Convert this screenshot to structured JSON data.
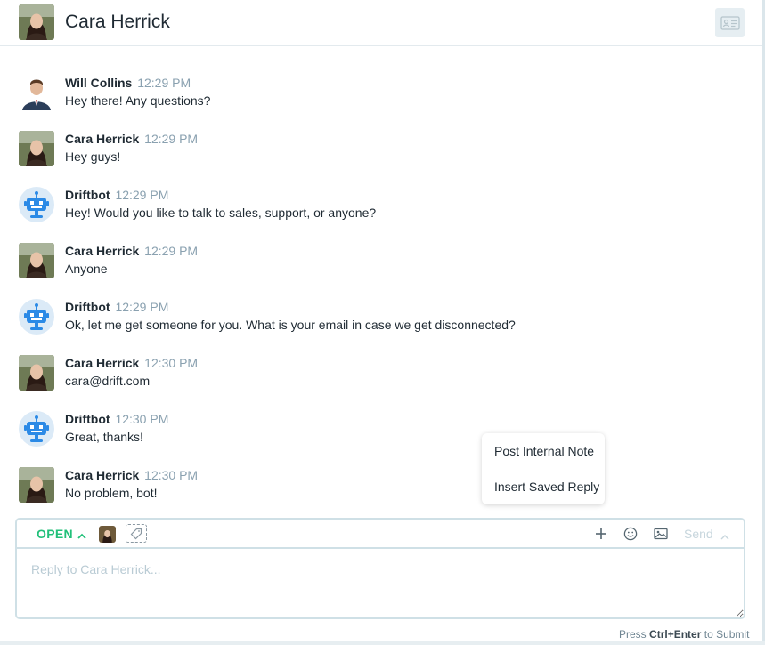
{
  "header": {
    "title": "Cara Herrick"
  },
  "messages": [
    {
      "name": "Will Collins",
      "time": "12:29 PM",
      "text": "Hey there! Any questions?",
      "avatar": "will"
    },
    {
      "name": "Cara Herrick",
      "time": "12:29 PM",
      "text": "Hey guys!",
      "avatar": "cara"
    },
    {
      "name": "Driftbot",
      "time": "12:29 PM",
      "text": "Hey! Would you like to talk to sales, support, or anyone?",
      "avatar": "bot"
    },
    {
      "name": "Cara Herrick",
      "time": "12:29 PM",
      "text": "Anyone",
      "avatar": "cara"
    },
    {
      "name": "Driftbot",
      "time": "12:29 PM",
      "text": "Ok, let me get someone for you. What is your email in case we get disconnected?",
      "avatar": "bot"
    },
    {
      "name": "Cara Herrick",
      "time": "12:30 PM",
      "text": "cara@drift.com",
      "avatar": "cara"
    },
    {
      "name": "Driftbot",
      "time": "12:30 PM",
      "text": "Great, thanks!",
      "avatar": "bot"
    },
    {
      "name": "Cara Herrick",
      "time": "12:30 PM",
      "text": "No problem, bot!",
      "avatar": "cara"
    }
  ],
  "popup": {
    "items": [
      {
        "label": "Post Internal Note"
      },
      {
        "label": "Insert Saved Reply"
      }
    ]
  },
  "composer": {
    "status": "OPEN",
    "send_label": "Send",
    "placeholder": "Reply to Cara Herrick...",
    "icons": [
      "plus-icon",
      "emoji-icon",
      "image-icon",
      "tag-icon",
      "chevron-up-icon",
      "contact-card-icon"
    ]
  },
  "hint": {
    "prefix": "Press",
    "keys": "Ctrl+Enter",
    "suffix": "to Submit"
  },
  "colors": {
    "accent_green": "#22c07a",
    "bot_blue": "#2b8ae6",
    "timestamp": "#8aa1b0",
    "border": "#cfe0e6"
  }
}
